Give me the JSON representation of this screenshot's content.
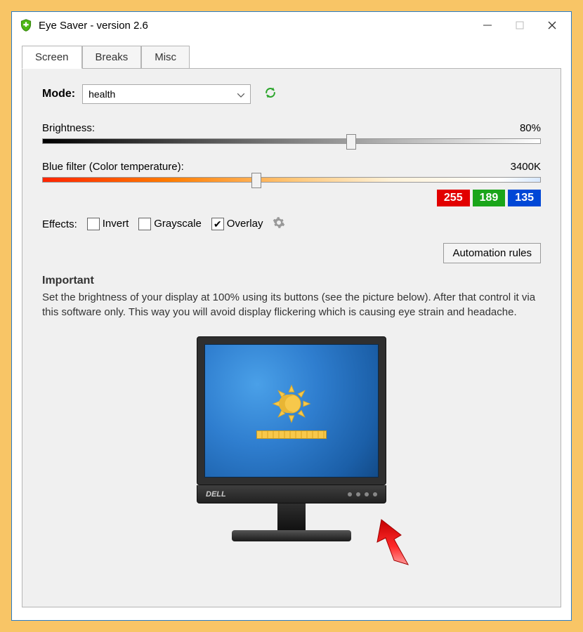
{
  "titlebar": {
    "title": "Eye Saver - version 2.6"
  },
  "tabs": {
    "screen": "Screen",
    "breaks": "Breaks",
    "misc": "Misc"
  },
  "screen": {
    "mode_label": "Mode:",
    "mode_value": "health",
    "brightness_label": "Brightness:",
    "brightness_value": "80%",
    "brightness_percent": 62,
    "bluefilter_label": "Blue filter (Color temperature):",
    "bluefilter_value": "3400K",
    "bluefilter_percent": 43,
    "rgb": {
      "r": "255",
      "g": "189",
      "b": "135"
    },
    "effects_label": "Effects:",
    "effects": {
      "invert": "Invert",
      "grayscale": "Grayscale",
      "overlay": "Overlay"
    },
    "automation_btn": "Automation rules",
    "notice_heading": "Important",
    "notice_body": "Set the brightness of your display at 100% using its buttons (see the picture below). After that control it via this software only. This way you will avoid display flickering which is causing eye strain and headache.",
    "monitor_brand": "DELL"
  }
}
